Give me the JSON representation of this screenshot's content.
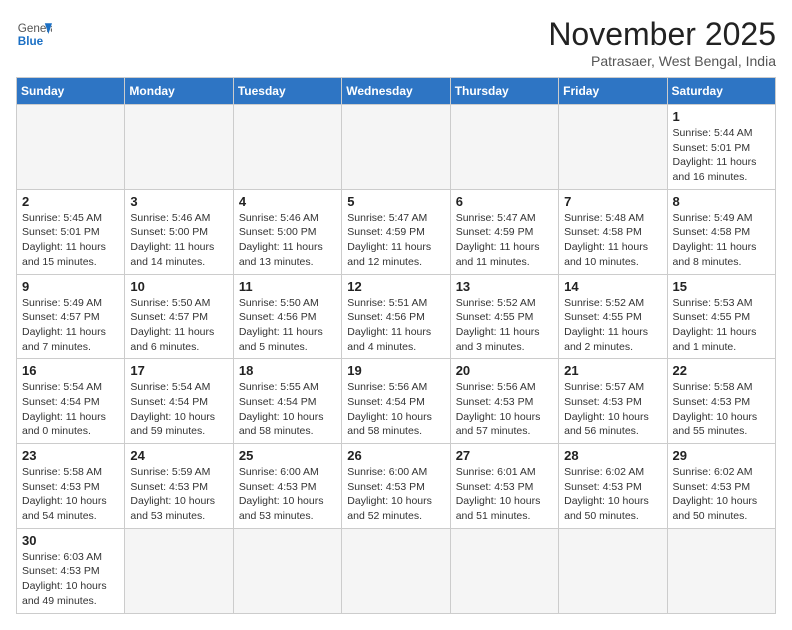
{
  "logo": {
    "general": "General",
    "blue": "Blue"
  },
  "title": "November 2025",
  "subtitle": "Patrasaer, West Bengal, India",
  "days_of_week": [
    "Sunday",
    "Monday",
    "Tuesday",
    "Wednesday",
    "Thursday",
    "Friday",
    "Saturday"
  ],
  "weeks": [
    [
      {
        "day": "",
        "info": ""
      },
      {
        "day": "",
        "info": ""
      },
      {
        "day": "",
        "info": ""
      },
      {
        "day": "",
        "info": ""
      },
      {
        "day": "",
        "info": ""
      },
      {
        "day": "",
        "info": ""
      },
      {
        "day": "1",
        "info": "Sunrise: 5:44 AM\nSunset: 5:01 PM\nDaylight: 11 hours and 16 minutes."
      }
    ],
    [
      {
        "day": "2",
        "info": "Sunrise: 5:45 AM\nSunset: 5:01 PM\nDaylight: 11 hours and 15 minutes."
      },
      {
        "day": "3",
        "info": "Sunrise: 5:46 AM\nSunset: 5:00 PM\nDaylight: 11 hours and 14 minutes."
      },
      {
        "day": "4",
        "info": "Sunrise: 5:46 AM\nSunset: 5:00 PM\nDaylight: 11 hours and 13 minutes."
      },
      {
        "day": "5",
        "info": "Sunrise: 5:47 AM\nSunset: 4:59 PM\nDaylight: 11 hours and 12 minutes."
      },
      {
        "day": "6",
        "info": "Sunrise: 5:47 AM\nSunset: 4:59 PM\nDaylight: 11 hours and 11 minutes."
      },
      {
        "day": "7",
        "info": "Sunrise: 5:48 AM\nSunset: 4:58 PM\nDaylight: 11 hours and 10 minutes."
      },
      {
        "day": "8",
        "info": "Sunrise: 5:49 AM\nSunset: 4:58 PM\nDaylight: 11 hours and 8 minutes."
      }
    ],
    [
      {
        "day": "9",
        "info": "Sunrise: 5:49 AM\nSunset: 4:57 PM\nDaylight: 11 hours and 7 minutes."
      },
      {
        "day": "10",
        "info": "Sunrise: 5:50 AM\nSunset: 4:57 PM\nDaylight: 11 hours and 6 minutes."
      },
      {
        "day": "11",
        "info": "Sunrise: 5:50 AM\nSunset: 4:56 PM\nDaylight: 11 hours and 5 minutes."
      },
      {
        "day": "12",
        "info": "Sunrise: 5:51 AM\nSunset: 4:56 PM\nDaylight: 11 hours and 4 minutes."
      },
      {
        "day": "13",
        "info": "Sunrise: 5:52 AM\nSunset: 4:55 PM\nDaylight: 11 hours and 3 minutes."
      },
      {
        "day": "14",
        "info": "Sunrise: 5:52 AM\nSunset: 4:55 PM\nDaylight: 11 hours and 2 minutes."
      },
      {
        "day": "15",
        "info": "Sunrise: 5:53 AM\nSunset: 4:55 PM\nDaylight: 11 hours and 1 minute."
      }
    ],
    [
      {
        "day": "16",
        "info": "Sunrise: 5:54 AM\nSunset: 4:54 PM\nDaylight: 11 hours and 0 minutes."
      },
      {
        "day": "17",
        "info": "Sunrise: 5:54 AM\nSunset: 4:54 PM\nDaylight: 10 hours and 59 minutes."
      },
      {
        "day": "18",
        "info": "Sunrise: 5:55 AM\nSunset: 4:54 PM\nDaylight: 10 hours and 58 minutes."
      },
      {
        "day": "19",
        "info": "Sunrise: 5:56 AM\nSunset: 4:54 PM\nDaylight: 10 hours and 58 minutes."
      },
      {
        "day": "20",
        "info": "Sunrise: 5:56 AM\nSunset: 4:53 PM\nDaylight: 10 hours and 57 minutes."
      },
      {
        "day": "21",
        "info": "Sunrise: 5:57 AM\nSunset: 4:53 PM\nDaylight: 10 hours and 56 minutes."
      },
      {
        "day": "22",
        "info": "Sunrise: 5:58 AM\nSunset: 4:53 PM\nDaylight: 10 hours and 55 minutes."
      }
    ],
    [
      {
        "day": "23",
        "info": "Sunrise: 5:58 AM\nSunset: 4:53 PM\nDaylight: 10 hours and 54 minutes."
      },
      {
        "day": "24",
        "info": "Sunrise: 5:59 AM\nSunset: 4:53 PM\nDaylight: 10 hours and 53 minutes."
      },
      {
        "day": "25",
        "info": "Sunrise: 6:00 AM\nSunset: 4:53 PM\nDaylight: 10 hours and 53 minutes."
      },
      {
        "day": "26",
        "info": "Sunrise: 6:00 AM\nSunset: 4:53 PM\nDaylight: 10 hours and 52 minutes."
      },
      {
        "day": "27",
        "info": "Sunrise: 6:01 AM\nSunset: 4:53 PM\nDaylight: 10 hours and 51 minutes."
      },
      {
        "day": "28",
        "info": "Sunrise: 6:02 AM\nSunset: 4:53 PM\nDaylight: 10 hours and 50 minutes."
      },
      {
        "day": "29",
        "info": "Sunrise: 6:02 AM\nSunset: 4:53 PM\nDaylight: 10 hours and 50 minutes."
      }
    ],
    [
      {
        "day": "30",
        "info": "Sunrise: 6:03 AM\nSunset: 4:53 PM\nDaylight: 10 hours and 49 minutes."
      },
      {
        "day": "",
        "info": ""
      },
      {
        "day": "",
        "info": ""
      },
      {
        "day": "",
        "info": ""
      },
      {
        "day": "",
        "info": ""
      },
      {
        "day": "",
        "info": ""
      },
      {
        "day": "",
        "info": ""
      }
    ]
  ]
}
